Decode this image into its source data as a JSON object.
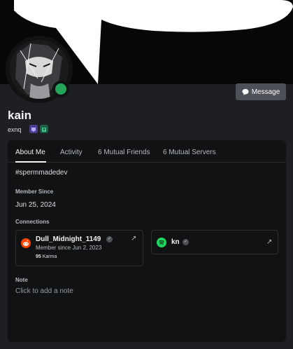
{
  "profile": {
    "display_name": "kain",
    "username": "exnq",
    "status": "online",
    "message_button": "Message",
    "bio": "#spermmadedev"
  },
  "tabs": [
    {
      "label": "About Me",
      "active": true
    },
    {
      "label": "Activity",
      "active": false
    },
    {
      "label": "6 Mutual Friends",
      "active": false
    },
    {
      "label": "6 Mutual Servers",
      "active": false
    }
  ],
  "about": {
    "member_since_label": "Member Since",
    "member_since": "Jun 25, 2024",
    "connections_label": "Connections",
    "note_label": "Note",
    "note_placeholder": "Click to add a note"
  },
  "connections": [
    {
      "service": "reddit-icon",
      "name": "Dull_Midnight_1149",
      "sub": "Member since Jun 2, 2023",
      "karma_value": "95",
      "karma_label": "Karma"
    },
    {
      "service": "spotify-icon",
      "name": "kn"
    }
  ],
  "colors": {
    "online": "#23a55a",
    "reddit": "#ff4500",
    "spotify": "#1ed760",
    "badge_nitro": "#9b84ee",
    "badge_boost": "#2f9e6f"
  }
}
